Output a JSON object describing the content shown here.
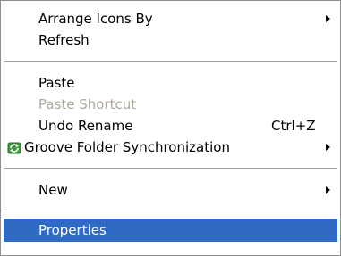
{
  "menu": {
    "arrange": {
      "label": "Arrange Icons By",
      "has_submenu": true
    },
    "refresh": {
      "label": "Refresh"
    },
    "paste": {
      "label": "Paste"
    },
    "paste_shortcut": {
      "label": "Paste Shortcut",
      "disabled": true
    },
    "undo_rename": {
      "label": "Undo Rename",
      "shortcut": "Ctrl+Z"
    },
    "groove": {
      "label": "Groove Folder Synchronization",
      "icon": "groove-sync-icon",
      "has_submenu": true
    },
    "new": {
      "label": "New",
      "has_submenu": true
    },
    "properties": {
      "label": "Properties",
      "selected": true
    }
  },
  "colors": {
    "highlight": "#316ac5",
    "disabled_text": "#aca899",
    "separator": "#aca899",
    "border": "#8e8f8f"
  }
}
